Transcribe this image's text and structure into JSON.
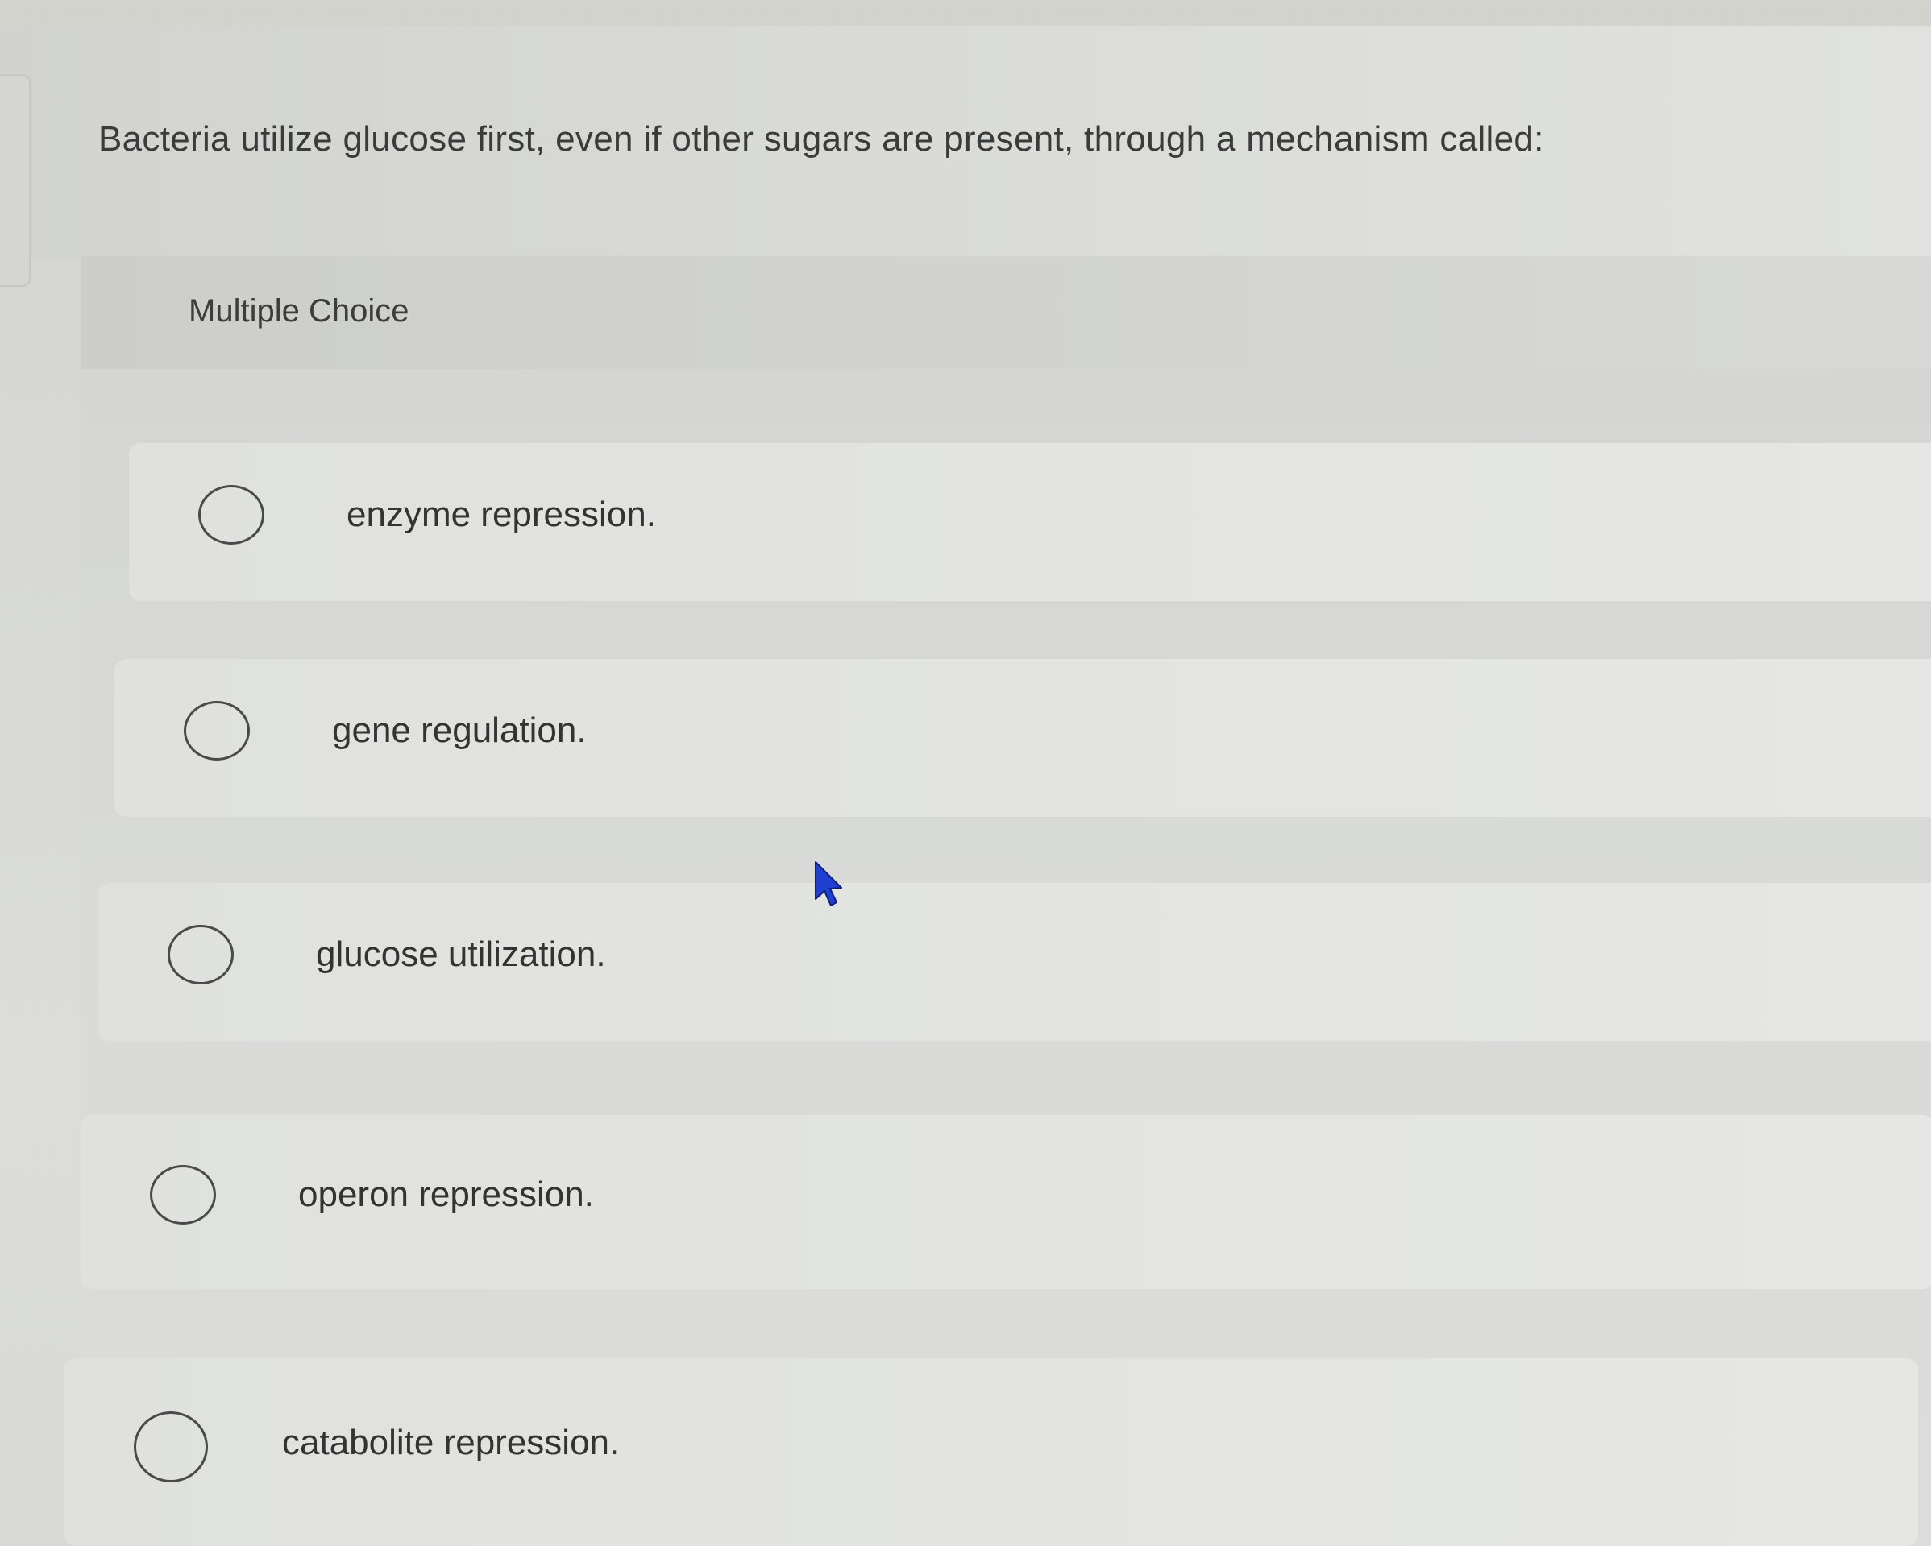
{
  "question": {
    "text": "Bacteria utilize glucose first, even if other sugars are present, through a mechanism called:"
  },
  "multiple_choice": {
    "label": "Multiple Choice",
    "options": [
      {
        "label": "enzyme repression."
      },
      {
        "label": "gene regulation."
      },
      {
        "label": "glucose utilization."
      },
      {
        "label": "operon repression."
      },
      {
        "label": "catabolite repression."
      }
    ]
  },
  "colors": {
    "cursor": "#1f3fd1",
    "radio_border": "#4a4a4a",
    "text": "#3a3a3a"
  },
  "icons": {
    "cursor": "mouse-pointer-icon",
    "radio": "radio-circle-icon"
  }
}
